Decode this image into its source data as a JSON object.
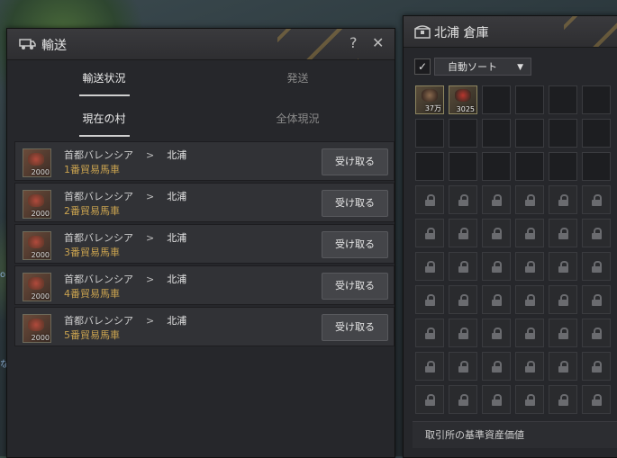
{
  "transport": {
    "title": "輸送",
    "help": "?",
    "close": "✕",
    "tabs_top": [
      {
        "label": "輸送状況",
        "active": true
      },
      {
        "label": "発送",
        "active": false
      }
    ],
    "tabs_sub": [
      {
        "label": "現在の村",
        "active": true
      },
      {
        "label": "全体現況",
        "active": false
      }
    ],
    "rows": [
      {
        "count": "2000",
        "origin": "首都バレンシア",
        "arrow": ">",
        "dest": "北浦",
        "wagon": "1番貿易馬車",
        "button": "受け取る"
      },
      {
        "count": "2000",
        "origin": "首都バレンシア",
        "arrow": ">",
        "dest": "北浦",
        "wagon": "2番貿易馬車",
        "button": "受け取る"
      },
      {
        "count": "2000",
        "origin": "首都バレンシア",
        "arrow": ">",
        "dest": "北浦",
        "wagon": "3番貿易馬車",
        "button": "受け取る"
      },
      {
        "count": "2000",
        "origin": "首都バレンシア",
        "arrow": ">",
        "dest": "北浦",
        "wagon": "4番貿易馬車",
        "button": "受け取る"
      },
      {
        "count": "2000",
        "origin": "首都バレンシア",
        "arrow": ">",
        "dest": "北浦",
        "wagon": "5番貿易馬車",
        "button": "受け取る"
      }
    ]
  },
  "warehouse": {
    "title": "北浦 倉庫",
    "auto_sort_checked": true,
    "check_mark": "✓",
    "sort_label": "自動ソート",
    "caret": "▼",
    "items": [
      {
        "count": "37万",
        "color": "#8a6a4e"
      },
      {
        "count": "3025",
        "color": "#b8362e"
      }
    ],
    "grid": {
      "cols": 6,
      "rows": 10,
      "open_slots": 18
    },
    "footer": "取引所の基準資産価値"
  },
  "side": {
    "text": "な",
    "text2": "ob"
  }
}
